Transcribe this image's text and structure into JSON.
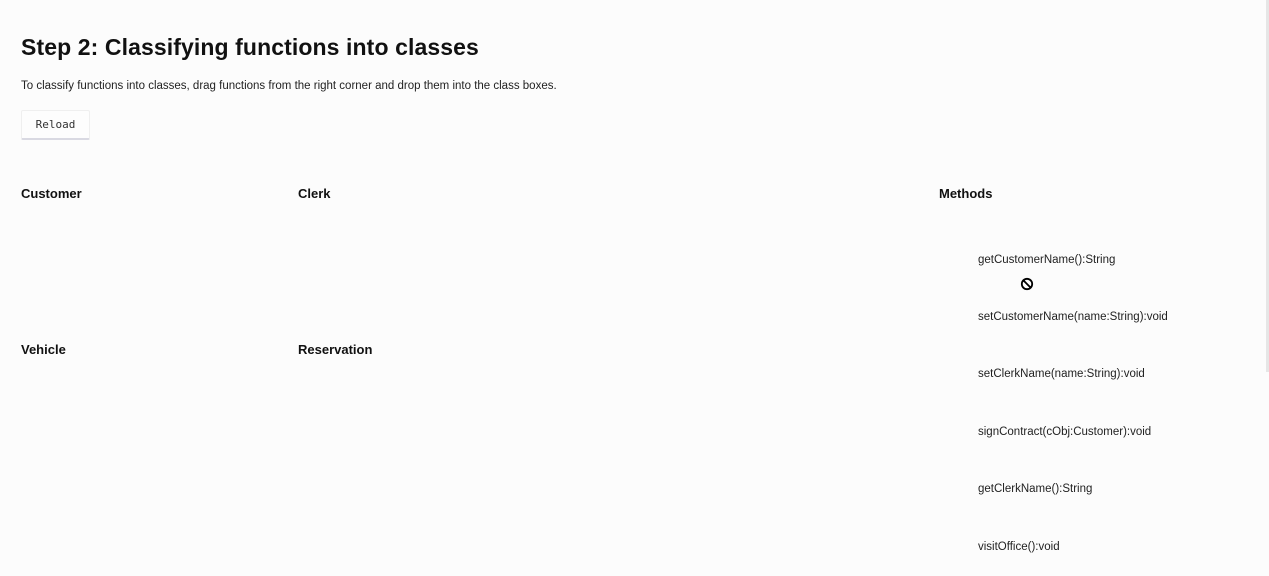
{
  "header": {
    "title": "Step 2: Classifying functions into classes",
    "instructions": "To classify functions into classes, drag functions from the right corner and drop them into the class boxes.",
    "reload_label": "Reload"
  },
  "classes": [
    {
      "name": "Customer"
    },
    {
      "name": "Clerk"
    },
    {
      "name": "Vehicle"
    },
    {
      "name": "Reservation"
    }
  ],
  "methods_panel": {
    "title": "Methods",
    "items": [
      "getCustomerName():String",
      "setCustomerName(name:String):void",
      "setClerkName(name:String):void",
      "signContract(cObj:Customer):void",
      "getClerkName():String",
      "visitOffice():void"
    ]
  },
  "cursor": {
    "icon": "not-allowed-icon"
  }
}
